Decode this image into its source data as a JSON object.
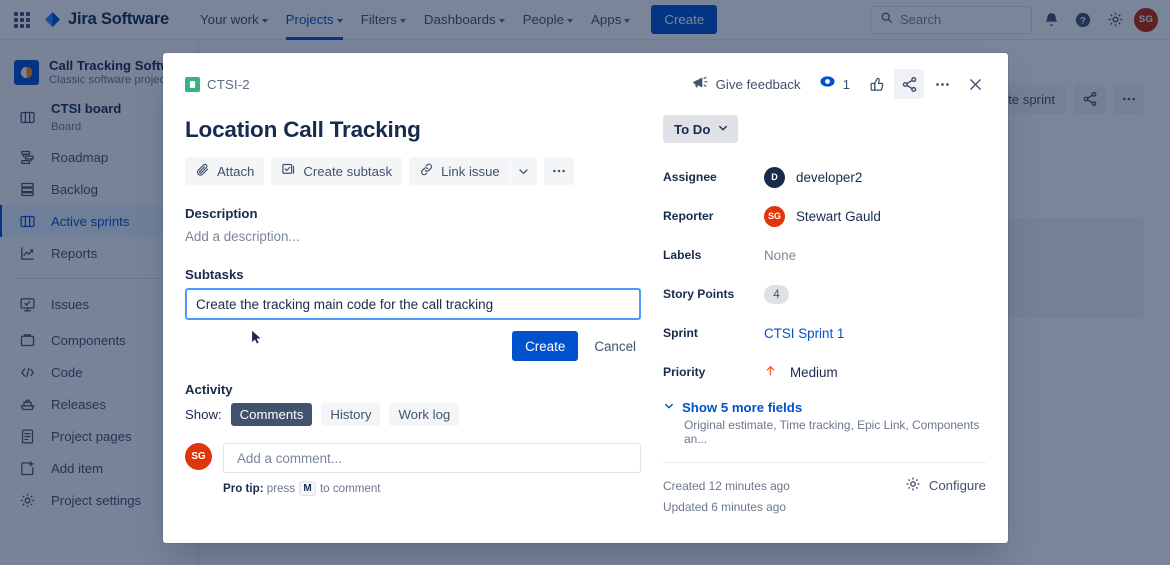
{
  "topnav": {
    "apps_icon": "apps-grid-icon",
    "brand": "Jira Software",
    "items": [
      {
        "label": "Your work",
        "has_chevron": true,
        "active": false
      },
      {
        "label": "Projects",
        "has_chevron": true,
        "active": true
      },
      {
        "label": "Filters",
        "has_chevron": true,
        "active": false
      },
      {
        "label": "Dashboards",
        "has_chevron": true,
        "active": false
      },
      {
        "label": "People",
        "has_chevron": true,
        "active": false
      },
      {
        "label": "Apps",
        "has_chevron": true,
        "active": false
      }
    ],
    "create_label": "Create",
    "search": {
      "placeholder": "Search",
      "value": ""
    },
    "icons": [
      "notifications-bell-icon",
      "help-icon",
      "settings-gear-icon"
    ],
    "user_initials": "SG",
    "user_color": "#bf2600",
    "accent": "#0052cc"
  },
  "sidebar": {
    "project": {
      "title": "Call Tracking Software",
      "subtitle": "Classic software project"
    },
    "board": {
      "title": "CTSI board",
      "subtitle": "Board"
    },
    "items": [
      {
        "label": "Roadmap",
        "icon": "roadmap-icon",
        "active": false
      },
      {
        "label": "Backlog",
        "icon": "backlog-icon",
        "active": false
      },
      {
        "label": "Active sprints",
        "icon": "board-columns-icon",
        "active": true
      },
      {
        "label": "Reports",
        "icon": "reports-chart-icon",
        "active": false
      }
    ],
    "items2": [
      {
        "label": "Issues",
        "icon": "issues-icon",
        "active": false
      }
    ],
    "items3": [
      {
        "label": "Components",
        "icon": "components-icon",
        "active": false
      },
      {
        "label": "Code",
        "icon": "code-icon",
        "active": false
      },
      {
        "label": "Releases",
        "icon": "releases-ship-icon",
        "active": false
      },
      {
        "label": "Project pages",
        "icon": "pages-icon",
        "active": false
      },
      {
        "label": "Add item",
        "icon": "add-item-icon",
        "active": false
      },
      {
        "label": "Project settings",
        "icon": "settings-gear-icon",
        "active": false
      }
    ]
  },
  "background_board": {
    "complete_sprint_label": "ete sprint",
    "share_icon": "share-icon",
    "more_icon": "more-horizontal-icon"
  },
  "modal": {
    "issue_key": "CTSI-2",
    "issue_key_icon": "story-type-icon",
    "issue_key_icon_color": "#36b37e",
    "header": {
      "feedback_label": "Give feedback",
      "feedback_icon": "megaphone-icon",
      "watch_icon": "watch-eye-icon",
      "watch_count": "1",
      "vote_icon": "thumbs-up-icon",
      "share_icon": "share-icon",
      "more_icon": "more-horizontal-icon",
      "close_icon": "close-x-icon"
    },
    "title": "Location Call Tracking",
    "actions": [
      {
        "label": "Attach",
        "icon": "paperclip-icon"
      },
      {
        "label": "Create subtask",
        "icon": "subtask-checkbox-icon"
      },
      {
        "label": "Link issue",
        "icon": "link-chain-icon",
        "has_chevron": true
      }
    ],
    "actions_more_icon": "more-horizontal-icon",
    "description": {
      "label": "Description",
      "placeholder": "Add a description..."
    },
    "subtasks": {
      "label": "Subtasks",
      "input_value": "Create the tracking main code for the call tracking",
      "create_label": "Create",
      "cancel_label": "Cancel"
    },
    "activity": {
      "label": "Activity",
      "show_label": "Show:",
      "tabs": [
        {
          "label": "Comments",
          "active": true
        },
        {
          "label": "History",
          "active": false
        },
        {
          "label": "Work log",
          "active": false
        }
      ],
      "avatar_initials": "SG",
      "avatar_color": "#de350b",
      "comment_placeholder": "Add a comment...",
      "protip_prefix": "Pro tip:",
      "protip_mid": " press ",
      "protip_key": "M",
      "protip_suffix": " to comment"
    },
    "details": {
      "status": "To Do",
      "status_chevron_icon": "chevron-down-icon",
      "fields": [
        {
          "label": "Assignee",
          "value": "developer2",
          "avatar": "D",
          "avatar_color": "#172b4d",
          "type": "user"
        },
        {
          "label": "Reporter",
          "value": "Stewart Gauld",
          "avatar": "SG",
          "avatar_color": "#de350b",
          "type": "user"
        },
        {
          "label": "Labels",
          "value": "None",
          "type": "muted"
        },
        {
          "label": "Story Points",
          "value": "4",
          "type": "pill"
        },
        {
          "label": "Sprint",
          "value": "CTSI Sprint 1",
          "type": "link"
        },
        {
          "label": "Priority",
          "value": "Medium",
          "type": "priority",
          "icon": "priority-medium-up-arrow-icon",
          "icon_color": "#ff5630"
        }
      ],
      "more_fields_label": "Show 5 more fields",
      "more_fields_icon": "chevron-down-icon",
      "more_fields_sub": "Original estimate, Time tracking, Epic Link, Components an...",
      "created": "Created 12 minutes ago",
      "updated": "Updated 6 minutes ago",
      "configure_label": "Configure",
      "configure_icon": "settings-gear-icon"
    }
  }
}
